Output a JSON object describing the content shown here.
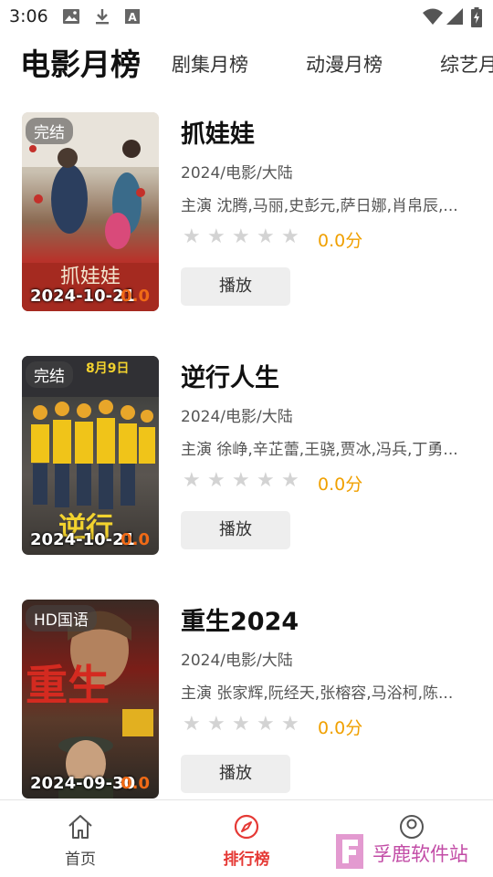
{
  "status_bar": {
    "time": "3:06",
    "left_icons": [
      "image-icon",
      "download-icon",
      "a-badge-icon"
    ],
    "right_icons": [
      "wifi-icon",
      "signal-icon",
      "battery-icon"
    ]
  },
  "tabs": [
    {
      "label": "电影月榜",
      "active": true
    },
    {
      "label": "剧集月榜",
      "active": false
    },
    {
      "label": "动漫月榜",
      "active": false
    },
    {
      "label": "综艺月",
      "active": false
    }
  ],
  "movies": [
    {
      "title": "抓娃娃",
      "badge": "完结",
      "poster_date": "2024-10-21",
      "poster_score": "0.0",
      "meta": "2024/电影/大陆",
      "cast": "主演 沈腾,马丽,史彭元,萨日娜,肖帛辰,...",
      "rating_stars": 0,
      "score_text": "0.0分",
      "play_label": "播放"
    },
    {
      "title": "逆行人生",
      "badge": "完结",
      "poster_date": "2024-10-21",
      "poster_score": "0.0",
      "meta": "2024/电影/大陆",
      "cast": "主演 徐峥,辛芷蕾,王骁,贾冰,冯兵,丁勇...",
      "rating_stars": 0,
      "score_text": "0.0分",
      "play_label": "播放"
    },
    {
      "title": "重生2024",
      "badge": "HD国语",
      "poster_date": "2024-09-30",
      "poster_score": "0.0",
      "meta": "2024/电影/大陆",
      "cast": "主演 张家辉,阮经天,张榕容,马浴柯,陈...",
      "rating_stars": 0,
      "score_text": "0.0分",
      "play_label": "播放"
    }
  ],
  "bottom_nav": [
    {
      "label": "首页",
      "icon": "home-icon",
      "active": false
    },
    {
      "label": "排行榜",
      "icon": "compass-icon",
      "active": true
    },
    {
      "label": "",
      "icon": "profile-icon",
      "active": false
    }
  ],
  "watermark": {
    "text": "孚鹿软件站"
  },
  "colors": {
    "active_nav": "#e53935",
    "score": "#f0a000",
    "star_empty": "#d3d3d3",
    "play_bg": "#eeeeee"
  }
}
